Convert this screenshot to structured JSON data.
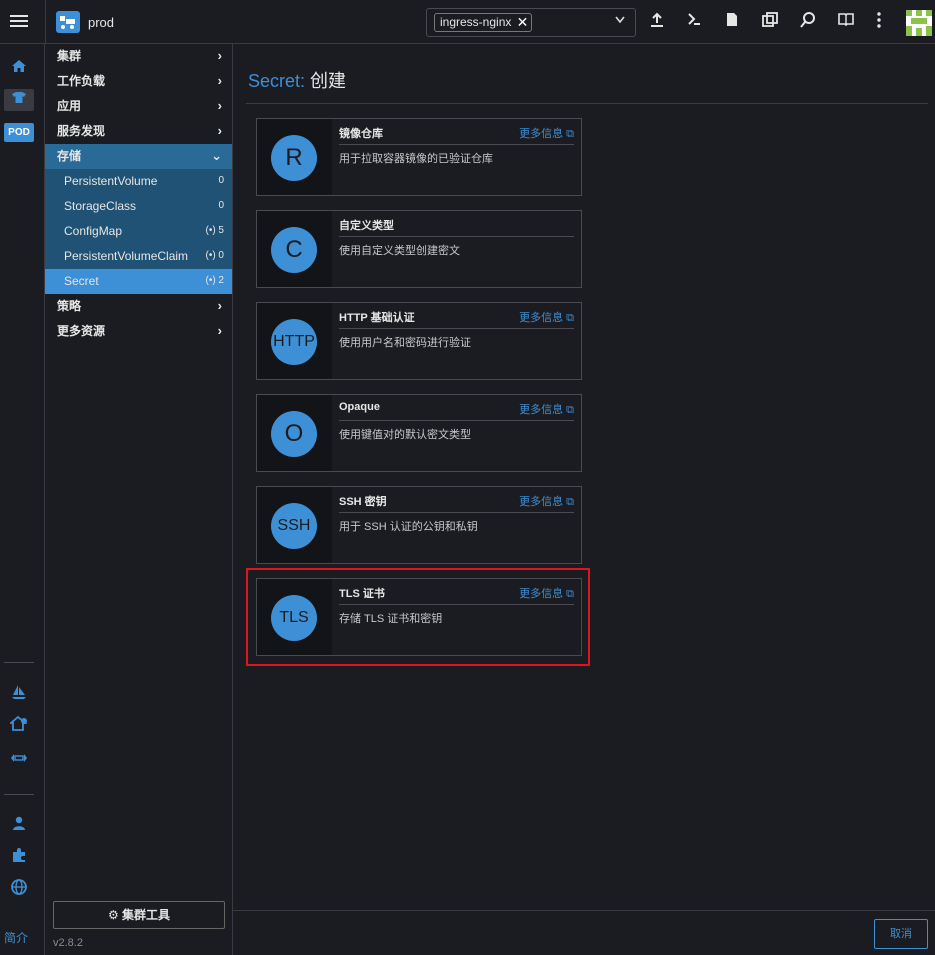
{
  "header": {
    "cluster_name": "prod",
    "namespace_chip": "ingress-nginx",
    "namespace_chip_remove": "✕",
    "toolbar_icons": [
      "upload-icon",
      "terminal-icon",
      "file-icon",
      "copy-icon",
      "search-icon",
      "book-icon",
      "more-vertical-icon"
    ]
  },
  "iconbar": {
    "pod_label": "POD",
    "about_label": "简介"
  },
  "sidebar": {
    "groups": [
      {
        "label": "集群"
      },
      {
        "label": "工作负载"
      },
      {
        "label": "应用"
      },
      {
        "label": "服务发现"
      },
      {
        "label": "存储"
      },
      {
        "label": "策略"
      },
      {
        "label": "更多资源"
      }
    ],
    "storage_items": [
      {
        "label": "PersistentVolume",
        "count": "0"
      },
      {
        "label": "StorageClass",
        "count": "0"
      },
      {
        "label": "ConfigMap",
        "count": "(•) 5"
      },
      {
        "label": "PersistentVolumeClaim",
        "count": "(•) 0"
      },
      {
        "label": "Secret",
        "count": "(•) 2"
      }
    ],
    "cluster_tools": "集群工具",
    "version": "v2.8.2"
  },
  "main": {
    "title_prefix": "Secret:",
    "title_action": "创建",
    "more_info": "更多信息",
    "cards": [
      {
        "letter": "R",
        "title": "镜像仓库",
        "desc": "用于拉取容器镜像的已验证仓库",
        "has_more": true
      },
      {
        "letter": "C",
        "title": "自定义类型",
        "desc": "使用自定义类型创建密文",
        "has_more": false
      },
      {
        "letter": "HTTP",
        "title": "HTTP 基础认证",
        "desc": "使用用户名和密码进行验证",
        "has_more": true
      },
      {
        "letter": "O",
        "title": "Opaque",
        "desc": "使用键值对的默认密文类型",
        "has_more": true
      },
      {
        "letter": "SSH",
        "title": "SSH 密钥",
        "desc": "用于 SSH 认证的公钥和私钥",
        "has_more": true
      },
      {
        "letter": "TLS",
        "title": "TLS 证书",
        "desc": "存储 TLS 证书和密钥",
        "has_more": true
      }
    ],
    "cancel": "取消"
  },
  "colors": {
    "accent": "#3d8fd6",
    "background": "#1b1c21",
    "highlight": "#e0141c"
  }
}
